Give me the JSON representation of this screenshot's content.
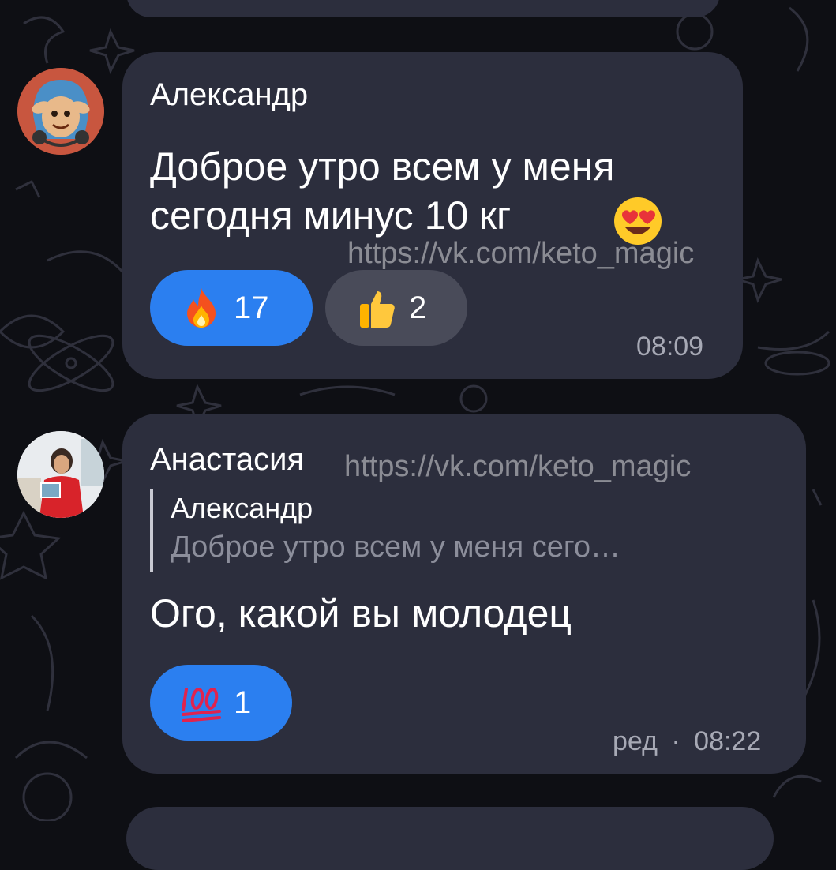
{
  "messages": [
    {
      "author": "Александр",
      "text_line1": "Доброе утро всем у меня",
      "text_line2": "сегодня минус 10 кг",
      "text_emoji": "heart-eyes-emoji",
      "watermark": "https://vk.com/keto_magic",
      "reactions": [
        {
          "emoji": "fire-emoji",
          "count": "17",
          "selected": true
        },
        {
          "emoji": "thumbs-up-emoji",
          "count": "2",
          "selected": false
        }
      ],
      "time": "08:09"
    },
    {
      "author": "Анастасия",
      "watermark": "https://vk.com/keto_magic",
      "reply": {
        "author": "Александр",
        "text": "Доброе утро всем у меня сего…"
      },
      "text": "Ого, какой вы молодец",
      "reactions": [
        {
          "emoji": "hundred-points-emoji",
          "count": "1",
          "selected": true
        }
      ],
      "edited_label": "ред",
      "separator": "·",
      "time": "08:22"
    }
  ],
  "colors": {
    "background": "#0e0f14",
    "bubble": "#2c2e3d",
    "reaction_active": "#2b7ff0",
    "reaction_inactive": "#494b59"
  }
}
